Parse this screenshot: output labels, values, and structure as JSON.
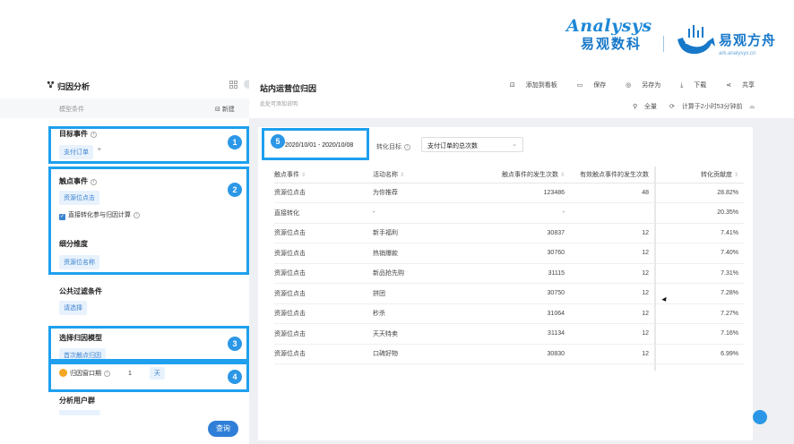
{
  "brand": {
    "logo1_en": "Analysys",
    "logo1_cn": "易观数科",
    "logo2_cn": "易观方舟",
    "logo2_url": "ark.analysys.cn"
  },
  "left": {
    "title": "归因分析",
    "model_label": "模型条件",
    "new_label": "新建",
    "target_event_title": "目标事件",
    "target_event_value": "支付订单",
    "touch_event_title": "触点事件",
    "touch_event_value": "资源位点击",
    "direct_convert_label": "直接转化参与归因计算",
    "dimension_title": "细分维度",
    "dimension_value": "资源位名称",
    "filter_title": "公共过滤条件",
    "filter_value": "请选择",
    "model_title": "选择归因模型",
    "model_value": "首次触点归因",
    "window_label": "归因窗口期",
    "window_value": "1",
    "window_unit": "天",
    "users_title": "分析用户群",
    "query_label": "查询"
  },
  "badges": [
    "1",
    "2",
    "3",
    "4",
    "5"
  ],
  "right": {
    "title": "站内运营位归因",
    "desc": "此处可添加说明",
    "toolbar": [
      "添加到看板",
      "保存",
      "另存为",
      "下载",
      "共享"
    ],
    "meta": [
      "全量",
      "计算于2小时53分钟前"
    ]
  },
  "controls": {
    "date_range": "2020/10/01 - 2020/10/08",
    "goal_label": "转化目标",
    "goal_value": "支付订单的总次数"
  },
  "table": {
    "headers": [
      "触点事件",
      "活动名称",
      "触点事件的发生次数",
      "有效触点事件的发生次数",
      "转化贡献度"
    ],
    "rows": [
      [
        "资源位点击",
        "为你推荐",
        "123486",
        "48",
        "28.82%"
      ],
      [
        "直接转化",
        "-",
        "-",
        "",
        "20.35%"
      ],
      [
        "资源位点击",
        "新手福利",
        "30837",
        "12",
        "7.41%"
      ],
      [
        "资源位点击",
        "热销爆款",
        "30760",
        "12",
        "7.40%"
      ],
      [
        "资源位点击",
        "新品抢先购",
        "31115",
        "12",
        "7.31%"
      ],
      [
        "资源位点击",
        "拼团",
        "30750",
        "12",
        "7.28%"
      ],
      [
        "资源位点击",
        "秒杀",
        "31064",
        "12",
        "7.27%"
      ],
      [
        "资源位点击",
        "天天特卖",
        "31134",
        "12",
        "7.16%"
      ],
      [
        "资源位点击",
        "口碑好物",
        "30830",
        "12",
        "6.99%"
      ]
    ]
  },
  "colors": {
    "highlight": "#1ea0ee",
    "primary": "#2f7fd8",
    "tag_bg": "#e8f2fd"
  }
}
